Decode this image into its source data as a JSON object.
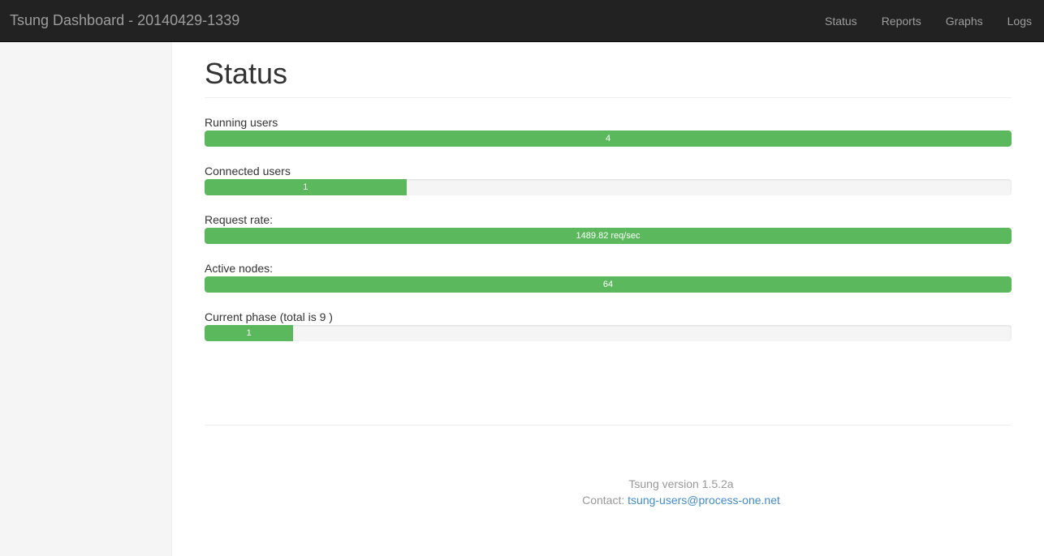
{
  "navbar": {
    "brand": "Tsung Dashboard - 20140429-1339",
    "items": [
      {
        "label": "Status"
      },
      {
        "label": "Reports"
      },
      {
        "label": "Graphs"
      },
      {
        "label": "Logs"
      }
    ]
  },
  "main": {
    "title": "Status",
    "stats": [
      {
        "label": "Running users",
        "value": "4",
        "fill_percent": 100
      },
      {
        "label": "Connected users",
        "value": "1",
        "fill_percent": 25
      },
      {
        "label": "Request rate:",
        "value": "1489.82 req/sec",
        "fill_percent": 100
      },
      {
        "label": "Active nodes:",
        "value": "64",
        "fill_percent": 100
      },
      {
        "label": "Current phase (total is 9 )",
        "value": "1",
        "fill_percent": 11
      }
    ]
  },
  "footer": {
    "version": "Tsung version 1.5.2a",
    "contact_label": "Contact:",
    "contact_email": "tsung-users@process-one.net"
  },
  "colors": {
    "navbar_bg": "#222222",
    "bar_fill": "#5cb85c",
    "link": "#428bca"
  }
}
